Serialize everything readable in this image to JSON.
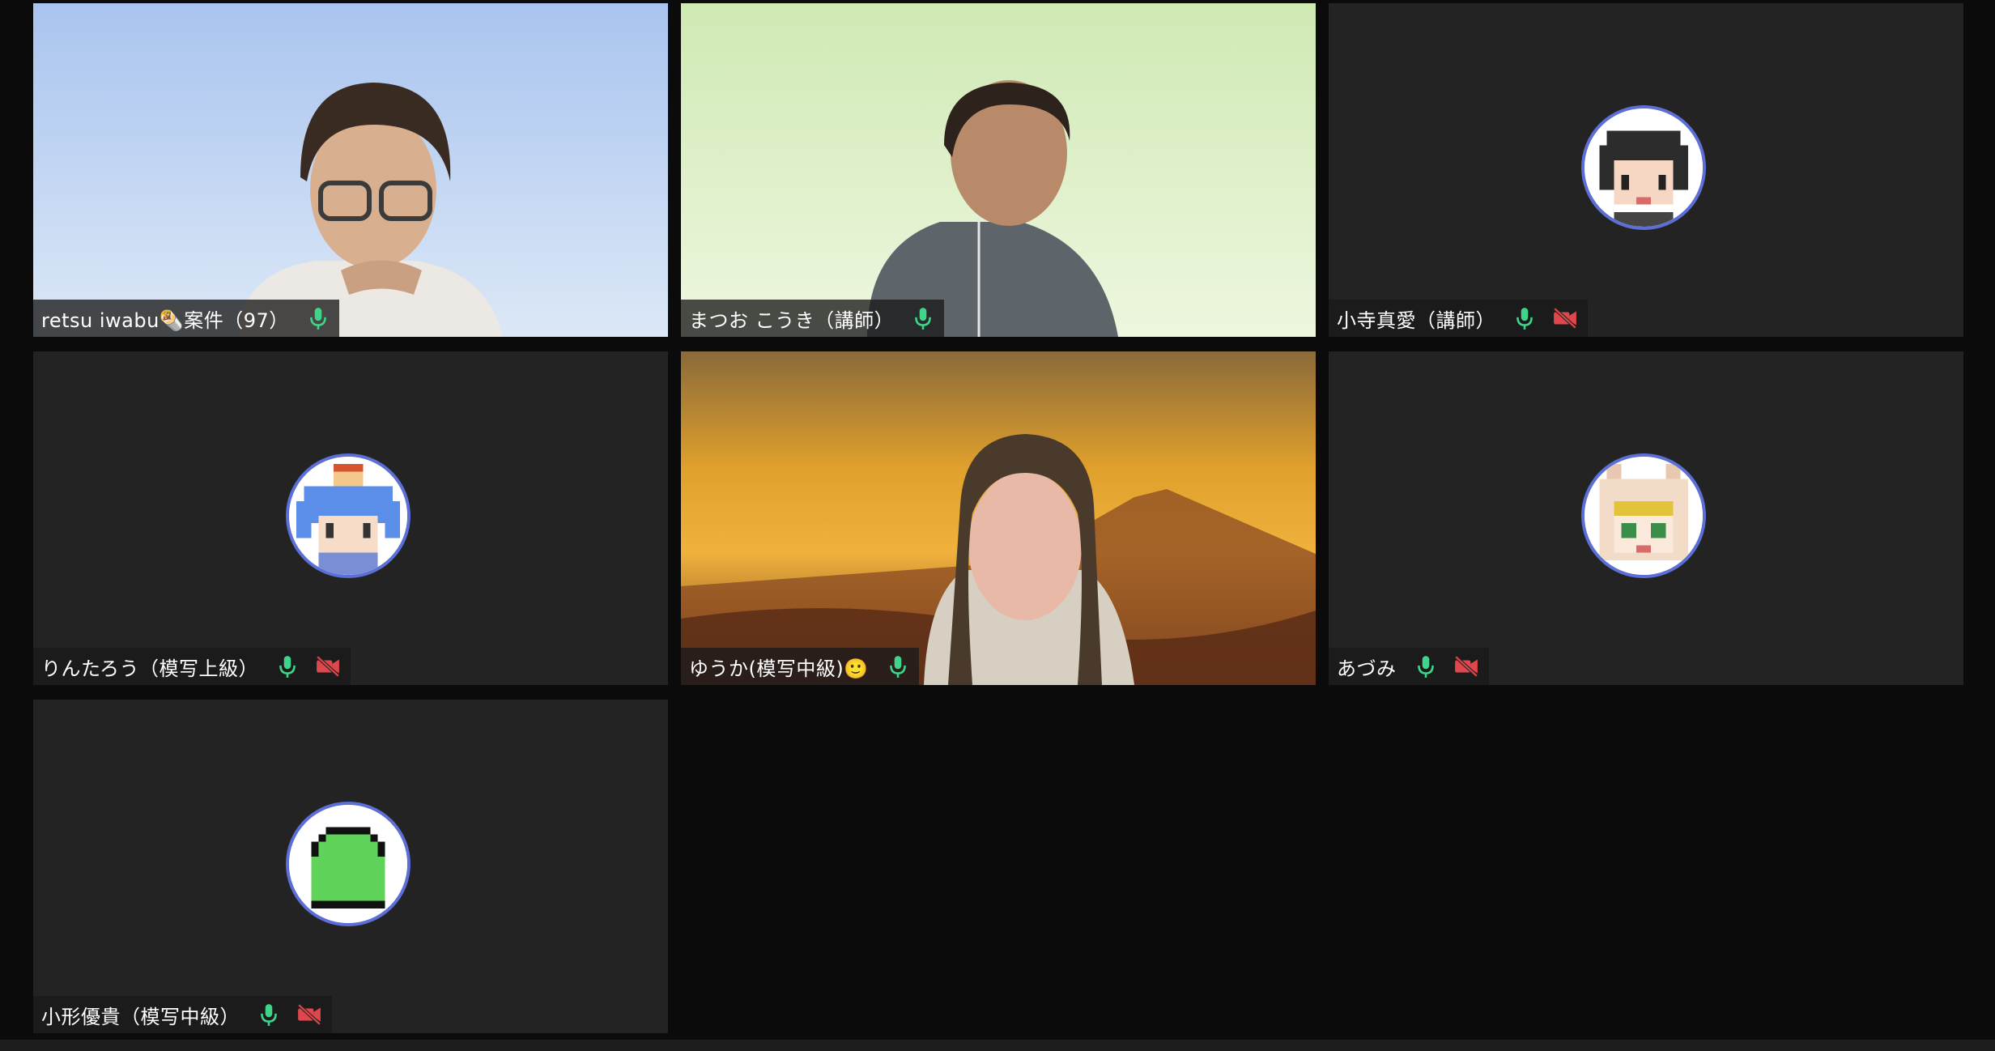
{
  "window": {
    "title": ""
  },
  "colors": {
    "background": "#0b0b0b",
    "tile": "#232323",
    "mic_on": "#3fd48a",
    "cam_off": "#e0474c",
    "avatar_ring": "#5b6fd6"
  },
  "participants": [
    {
      "name": "retsu iwabu🌯案件（97）",
      "mic": "on",
      "camera": "on",
      "view": "video"
    },
    {
      "name": "まつお こうき（講師）",
      "mic": "on",
      "camera": "on",
      "view": "video"
    },
    {
      "name": "小寺真愛（講師）",
      "mic": "on",
      "camera": "off",
      "view": "avatar",
      "avatar_icon": "pixel-avatar-dark-hair-icon"
    },
    {
      "name": "りんたろう（模写上級）",
      "mic": "on",
      "camera": "off",
      "view": "avatar",
      "avatar_icon": "pixel-avatar-blue-hair-icon"
    },
    {
      "name": "ゆうか(模写中級)🙂",
      "mic": "on",
      "camera": "on",
      "view": "video"
    },
    {
      "name": "あづみ",
      "mic": "on",
      "camera": "off",
      "view": "avatar",
      "avatar_icon": "pixel-avatar-animal-hood-icon"
    },
    {
      "name": "小形優貴（模写中級）",
      "mic": "on",
      "camera": "off",
      "view": "avatar",
      "avatar_icon": "pixel-avatar-green-blob-icon"
    }
  ]
}
